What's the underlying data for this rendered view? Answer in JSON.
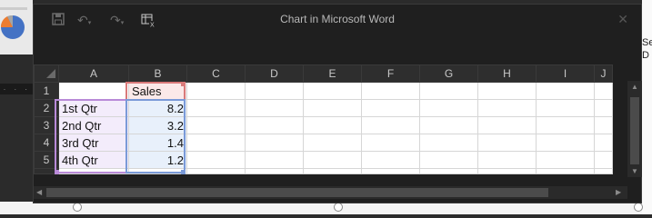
{
  "window": {
    "title": "Chart in Microsoft Word",
    "close_glyph": "✕",
    "save_icon": "save-icon",
    "undo_icon": "undo-icon",
    "redo_icon": "redo-icon",
    "edit_data_icon": "edit-data-in-excel-icon"
  },
  "sheet": {
    "columns": [
      "A",
      "B",
      "C",
      "D",
      "E",
      "F",
      "G",
      "H",
      "I",
      "J"
    ],
    "rows": [
      {
        "num": "1",
        "a": "",
        "b": "Sales"
      },
      {
        "num": "2",
        "a": "1st Qtr",
        "b": "8.2"
      },
      {
        "num": "3",
        "a": "2nd Qtr",
        "b": "3.2"
      },
      {
        "num": "4",
        "a": "3rd Qtr",
        "b": "1.4"
      },
      {
        "num": "5",
        "a": "4th Qtr",
        "b": "1.2"
      }
    ]
  },
  "background": {
    "ruler_text": ". . .",
    "right_text": "Se\nD"
  },
  "colors": {
    "category_range": "#b98ad8",
    "values_range": "#7a9ad8",
    "series_name": "#d97a7a"
  }
}
